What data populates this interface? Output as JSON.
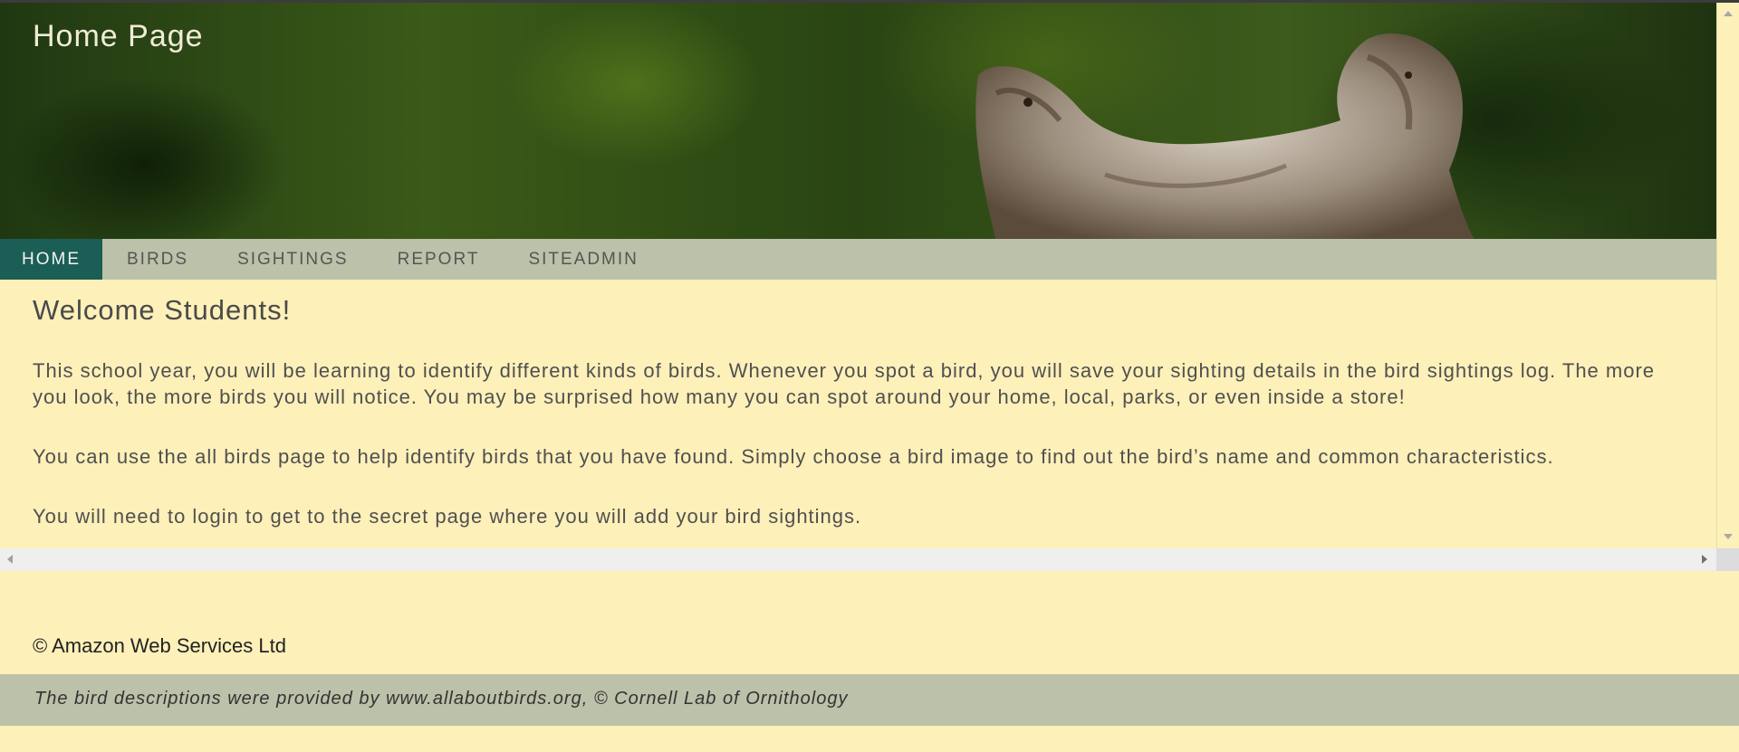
{
  "header": {
    "title": "Home Page"
  },
  "nav": {
    "items": [
      {
        "label": "HOME",
        "active": true
      },
      {
        "label": "BIRDS"
      },
      {
        "label": "SIGHTINGS"
      },
      {
        "label": "REPORT"
      },
      {
        "label": "SITEADMIN"
      }
    ]
  },
  "main": {
    "heading": "Welcome Students!",
    "paragraphs": [
      "This school year, you will be learning to identify different kinds of birds. Whenever you spot a bird, you will save your sighting details in the bird sightings log. The more you look, the more birds you will notice. You may be surprised how many you can spot around your home, local, parks, or even inside a store!",
      "You can use the all birds page to help identify birds that you have found. Simply choose a bird image to find out the bird’s name and common characteristics.",
      "You will need to login to get to the secret page where you will add your bird sightings."
    ]
  },
  "footer": {
    "copyright": "© Amazon Web Services Ltd",
    "credit": "The bird descriptions were provided by www.allaboutbirds.org, © Cornell Lab of Ornithology"
  },
  "colors": {
    "page_background": "#fdf0b9",
    "nav_background": "#bcc1a9",
    "nav_active": "#1b5e55"
  }
}
